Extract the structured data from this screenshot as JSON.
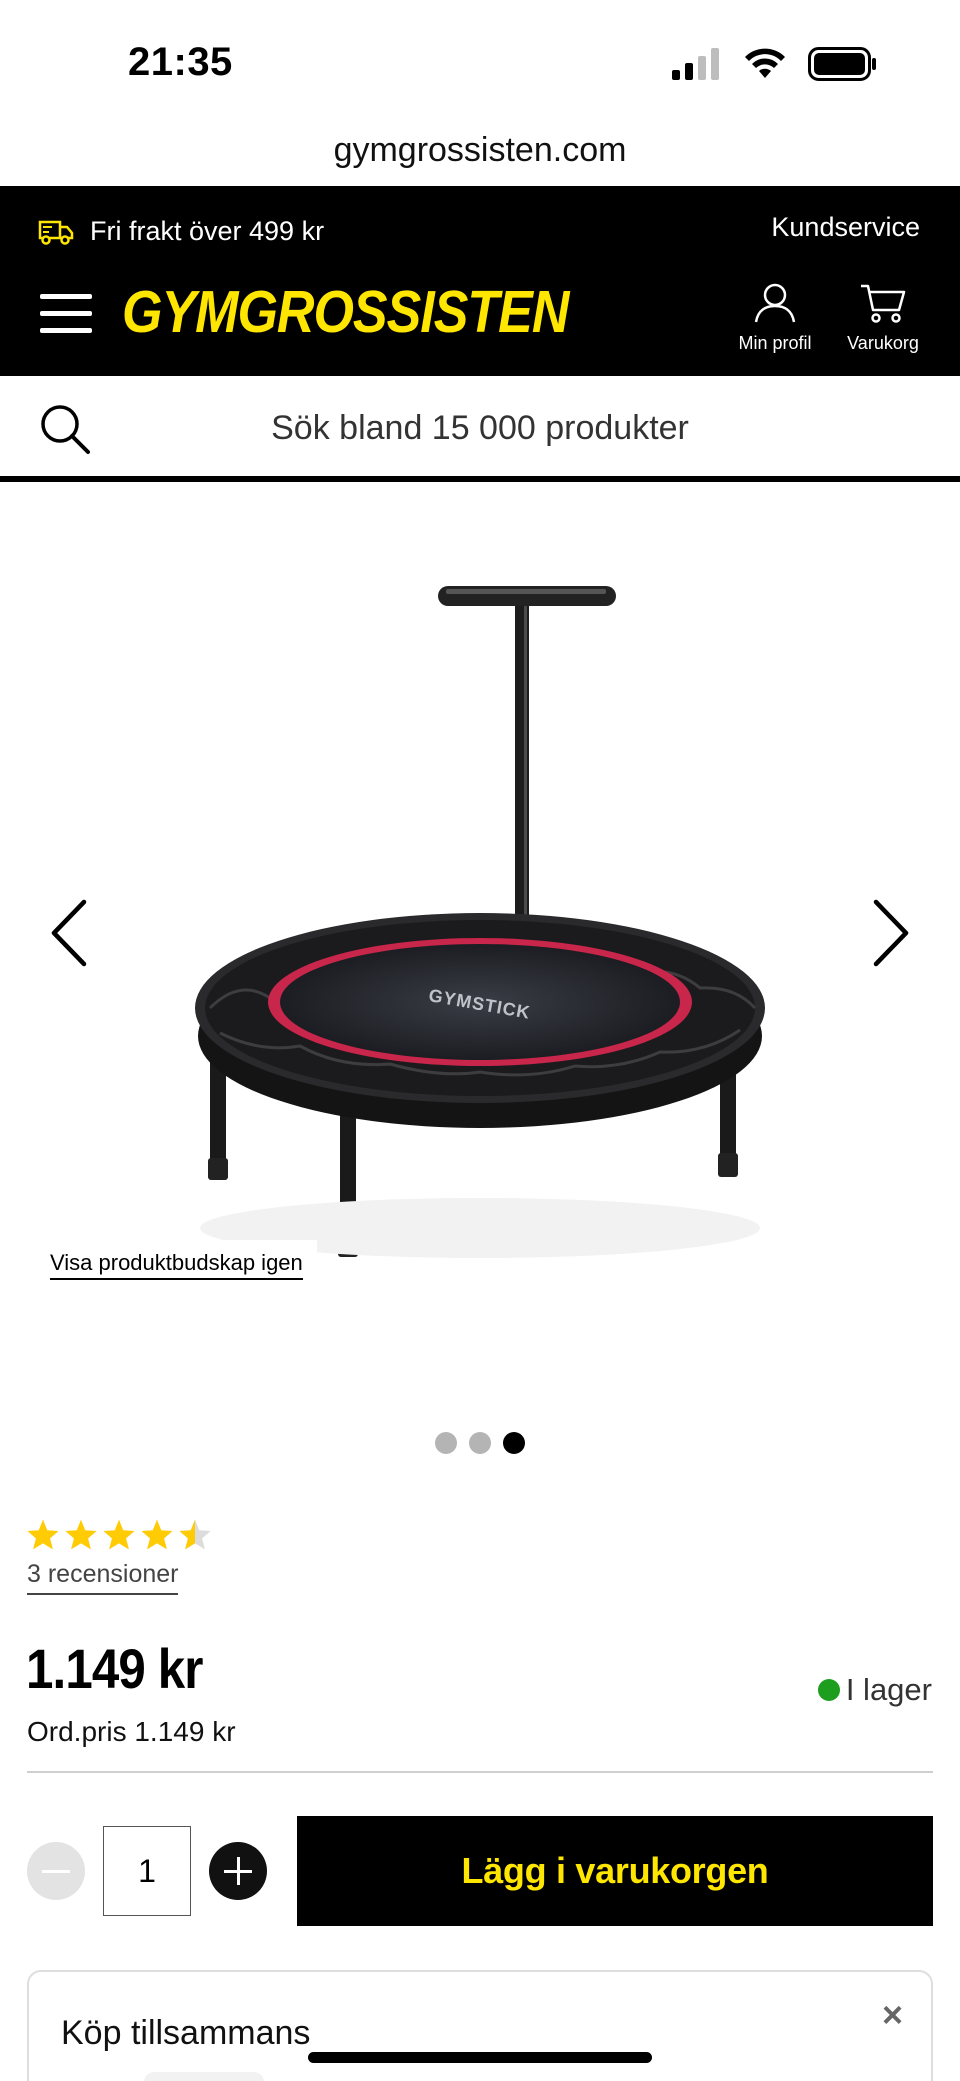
{
  "status_bar": {
    "time": "21:35"
  },
  "browser": {
    "url": "gymgrossisten.com"
  },
  "header": {
    "shipping_text": "Fri frakt över 499 kr",
    "customer_service": "Kundservice",
    "logo": "GYMGROSSISTEN",
    "profile_label": "Min profil",
    "cart_label": "Varukorg",
    "brand_color": "#ffe600"
  },
  "search": {
    "placeholder": "Sök bland 15 000 produkter"
  },
  "gallery": {
    "product_brand_print": "GYMSTICK",
    "show_message_link": "Visa produktbudskap igen",
    "image_count": 3,
    "active_index": 3
  },
  "product": {
    "rating": 4.5,
    "rating_max": 5,
    "reviews_label": "3 recensioner",
    "price": "1.149 kr",
    "regular_price": "Ord.pris 1.149 kr",
    "stock_status": "I lager",
    "stock_color": "#1e9e1e"
  },
  "purchase": {
    "quantity": "1",
    "add_to_cart_label": "Lägg i varukorgen"
  },
  "bundle": {
    "title": "Köp tillsammans",
    "close_symbol": "×"
  }
}
